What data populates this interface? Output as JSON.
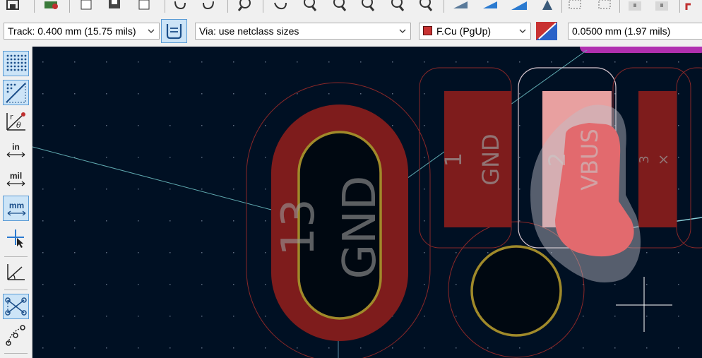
{
  "options_bar": {
    "track_width": "Track: 0.400 mm (15.75 mils)",
    "via_size": "Via: use netclass sizes",
    "layer": "F.Cu (PgUp)",
    "layer_color": "#c83232",
    "grid": "0.0500 mm (1.97 mils)"
  },
  "left_toolbar": {
    "units_in": "in",
    "units_mil": "mil",
    "units_mm": "mm",
    "polar_r": "r",
    "polar_theta": "θ"
  },
  "pcb": {
    "pads": [
      {
        "number": "13",
        "net": "GND"
      },
      {
        "number": "1",
        "net": "GND"
      },
      {
        "number": "2",
        "net": "VBUS"
      },
      {
        "number": "3",
        "net": "×"
      }
    ],
    "colors": {
      "background": "#001023",
      "copper_front": "#c83232",
      "pad_bright": "#ff2626",
      "highlight": "#e8a0a0",
      "hole_ring": "#a08a2a",
      "ratsnest": "#5faab0",
      "courtyard": "#9b2a2a",
      "outline_white": "#d8c8d0",
      "magenta_layer": "#b030b0"
    }
  }
}
